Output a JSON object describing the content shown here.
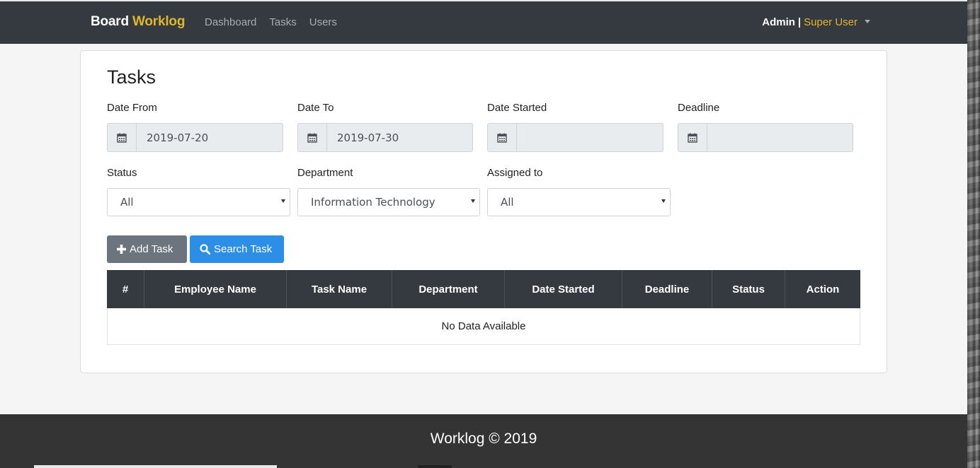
{
  "navbar": {
    "brand_part1": "Board",
    "brand_part2": "Worklog",
    "links": [
      "Dashboard",
      "Tasks",
      "Users"
    ],
    "user_name": "Admin",
    "separator": "|",
    "user_role": "Super User"
  },
  "page": {
    "title": "Tasks"
  },
  "filters": {
    "date_from": {
      "label": "Date From",
      "value": "2019-07-20"
    },
    "date_to": {
      "label": "Date To",
      "value": "2019-07-30"
    },
    "date_started": {
      "label": "Date Started",
      "value": ""
    },
    "deadline": {
      "label": "Deadline",
      "value": ""
    },
    "status": {
      "label": "Status",
      "value": "All"
    },
    "department": {
      "label": "Department",
      "value": "Information Technology"
    },
    "assigned_to": {
      "label": "Assigned to",
      "value": "All"
    }
  },
  "buttons": {
    "add_task": "Add Task",
    "search_task": "Search Task"
  },
  "table": {
    "columns": [
      "#",
      "Employee Name",
      "Task Name",
      "Department",
      "Date Started",
      "Deadline",
      "Status",
      "Action"
    ],
    "empty_message": "No Data Available"
  },
  "footer": {
    "text": "Worklog © 2019"
  },
  "colors": {
    "navbar_bg": "#343a40",
    "accent": "#e0b72a",
    "primary": "#2c8ee6",
    "secondary": "#6c757d"
  },
  "icons": {
    "calendar": "calendar-icon",
    "plus": "plus-icon",
    "search": "search-icon"
  }
}
